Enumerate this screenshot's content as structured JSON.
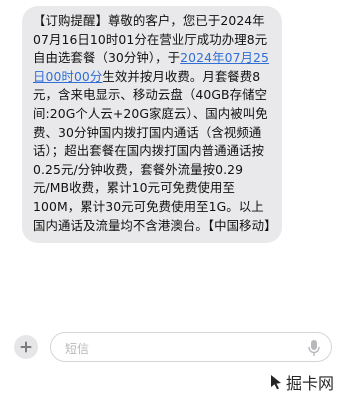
{
  "message": {
    "part1": "【订购提醒】尊敬的客户，您已于2024年07月16日10时01分在营业厅成功办理8元自由选套餐（30分钟），于",
    "link": "2024年07月25日00时00分",
    "part2": "生效并按月收费。月套餐费8元，含来电显示、移动云盘（40GB存储空间:20G个人云+20G家庭云）、国内被叫免费、30分钟国内拨打国内通话（含视频通话）；超出套餐在国内拨打国内普通通话按0.25元/分钟收费，套餐外流量按0.29元/MB收费，累计10元可免费使用至100M，累计30元可免费使用至1G。以上国内通话及流量均不含港澳台。【中国移动】"
  },
  "composer": {
    "placeholder": "短信"
  },
  "watermark": {
    "text": "掘卡网"
  },
  "icons": {
    "plus": "plus-icon",
    "mic": "microphone-icon",
    "cursor": "cursor-icon"
  },
  "colors": {
    "bubble": "#e9e9eb",
    "link": "#2f6fd6",
    "text": "#111111"
  }
}
